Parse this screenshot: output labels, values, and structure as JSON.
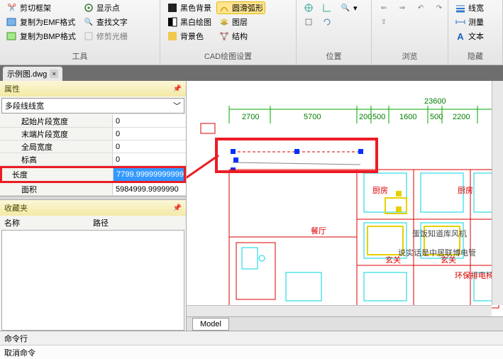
{
  "ribbon": {
    "groups": [
      {
        "label": "工具",
        "items": [
          "剪切框架",
          "复制为EMF格式",
          "复制为BMP格式",
          "显示点",
          "查找文字",
          "修剪光栅"
        ]
      },
      {
        "label": "CAD绘图设置",
        "items": [
          "黑色背景",
          "黑白绘图",
          "背景色",
          "圆滑弧形",
          "图层",
          "结构"
        ]
      },
      {
        "label": "位置",
        "items": []
      },
      {
        "label": "浏览",
        "items": []
      },
      {
        "label": "隐藏",
        "items": [
          "线宽",
          "测量",
          "文本"
        ]
      }
    ]
  },
  "tab": {
    "name": "示例图.dwg"
  },
  "panel": {
    "title": "属性",
    "type": "多段线线宽",
    "rows": [
      {
        "key": "起始片段宽度",
        "val": "0"
      },
      {
        "key": "末端片段宽度",
        "val": "0"
      },
      {
        "key": "全局宽度",
        "val": "0"
      },
      {
        "key": "标高",
        "val": "0"
      },
      {
        "key": "长度",
        "val": "7799.99999999999",
        "selected": true,
        "highlighted": true
      },
      {
        "key": "面积",
        "val": "5984999.9999990"
      }
    ],
    "favorites": {
      "title": "收藏夹",
      "col1": "名称",
      "col2": "路径"
    }
  },
  "drawing": {
    "dims": [
      "2700",
      "5700",
      "200",
      "500",
      "1600",
      "500",
      "2200"
    ],
    "total": "23600",
    "labels": {
      "kitchen": "厨房",
      "dining": "餐厅",
      "entry": "玄关",
      "env": "环保排电椅",
      "sub1": "蛋饭知道库风机",
      "sub2": "说实话是中居联博电管"
    }
  },
  "modeltab": "Model",
  "cmdline": "命令行",
  "status": "取消命令"
}
